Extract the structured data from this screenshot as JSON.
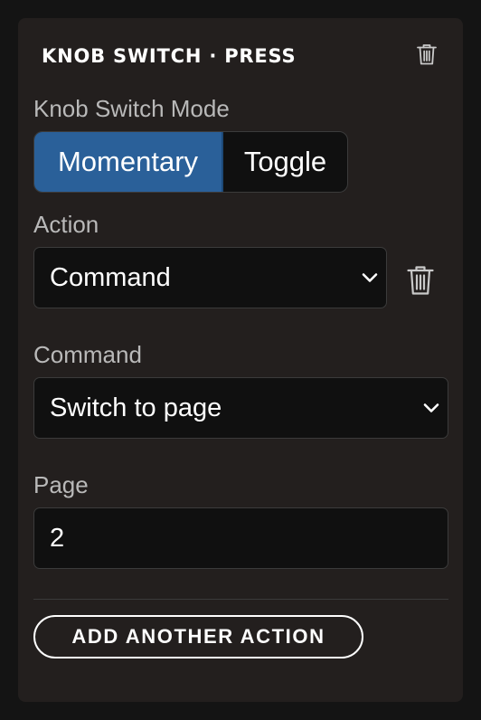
{
  "header": {
    "title": "KNOB SWITCH · PRESS",
    "delete_icon": "trash-icon"
  },
  "mode": {
    "label": "Knob Switch Mode",
    "options": [
      "Momentary",
      "Toggle"
    ],
    "selected": "Momentary"
  },
  "action": {
    "label": "Action",
    "value": "Command",
    "delete_icon": "trash-icon"
  },
  "command": {
    "label": "Command",
    "value": "Switch to page"
  },
  "page": {
    "label": "Page",
    "value": "2"
  },
  "footer": {
    "add_action_label": "ADD ANOTHER ACTION"
  },
  "colors": {
    "background": "#141414",
    "panel": "#231f1e",
    "accent": "#2a6099",
    "field": "#101010",
    "label": "#b9b9b9"
  }
}
